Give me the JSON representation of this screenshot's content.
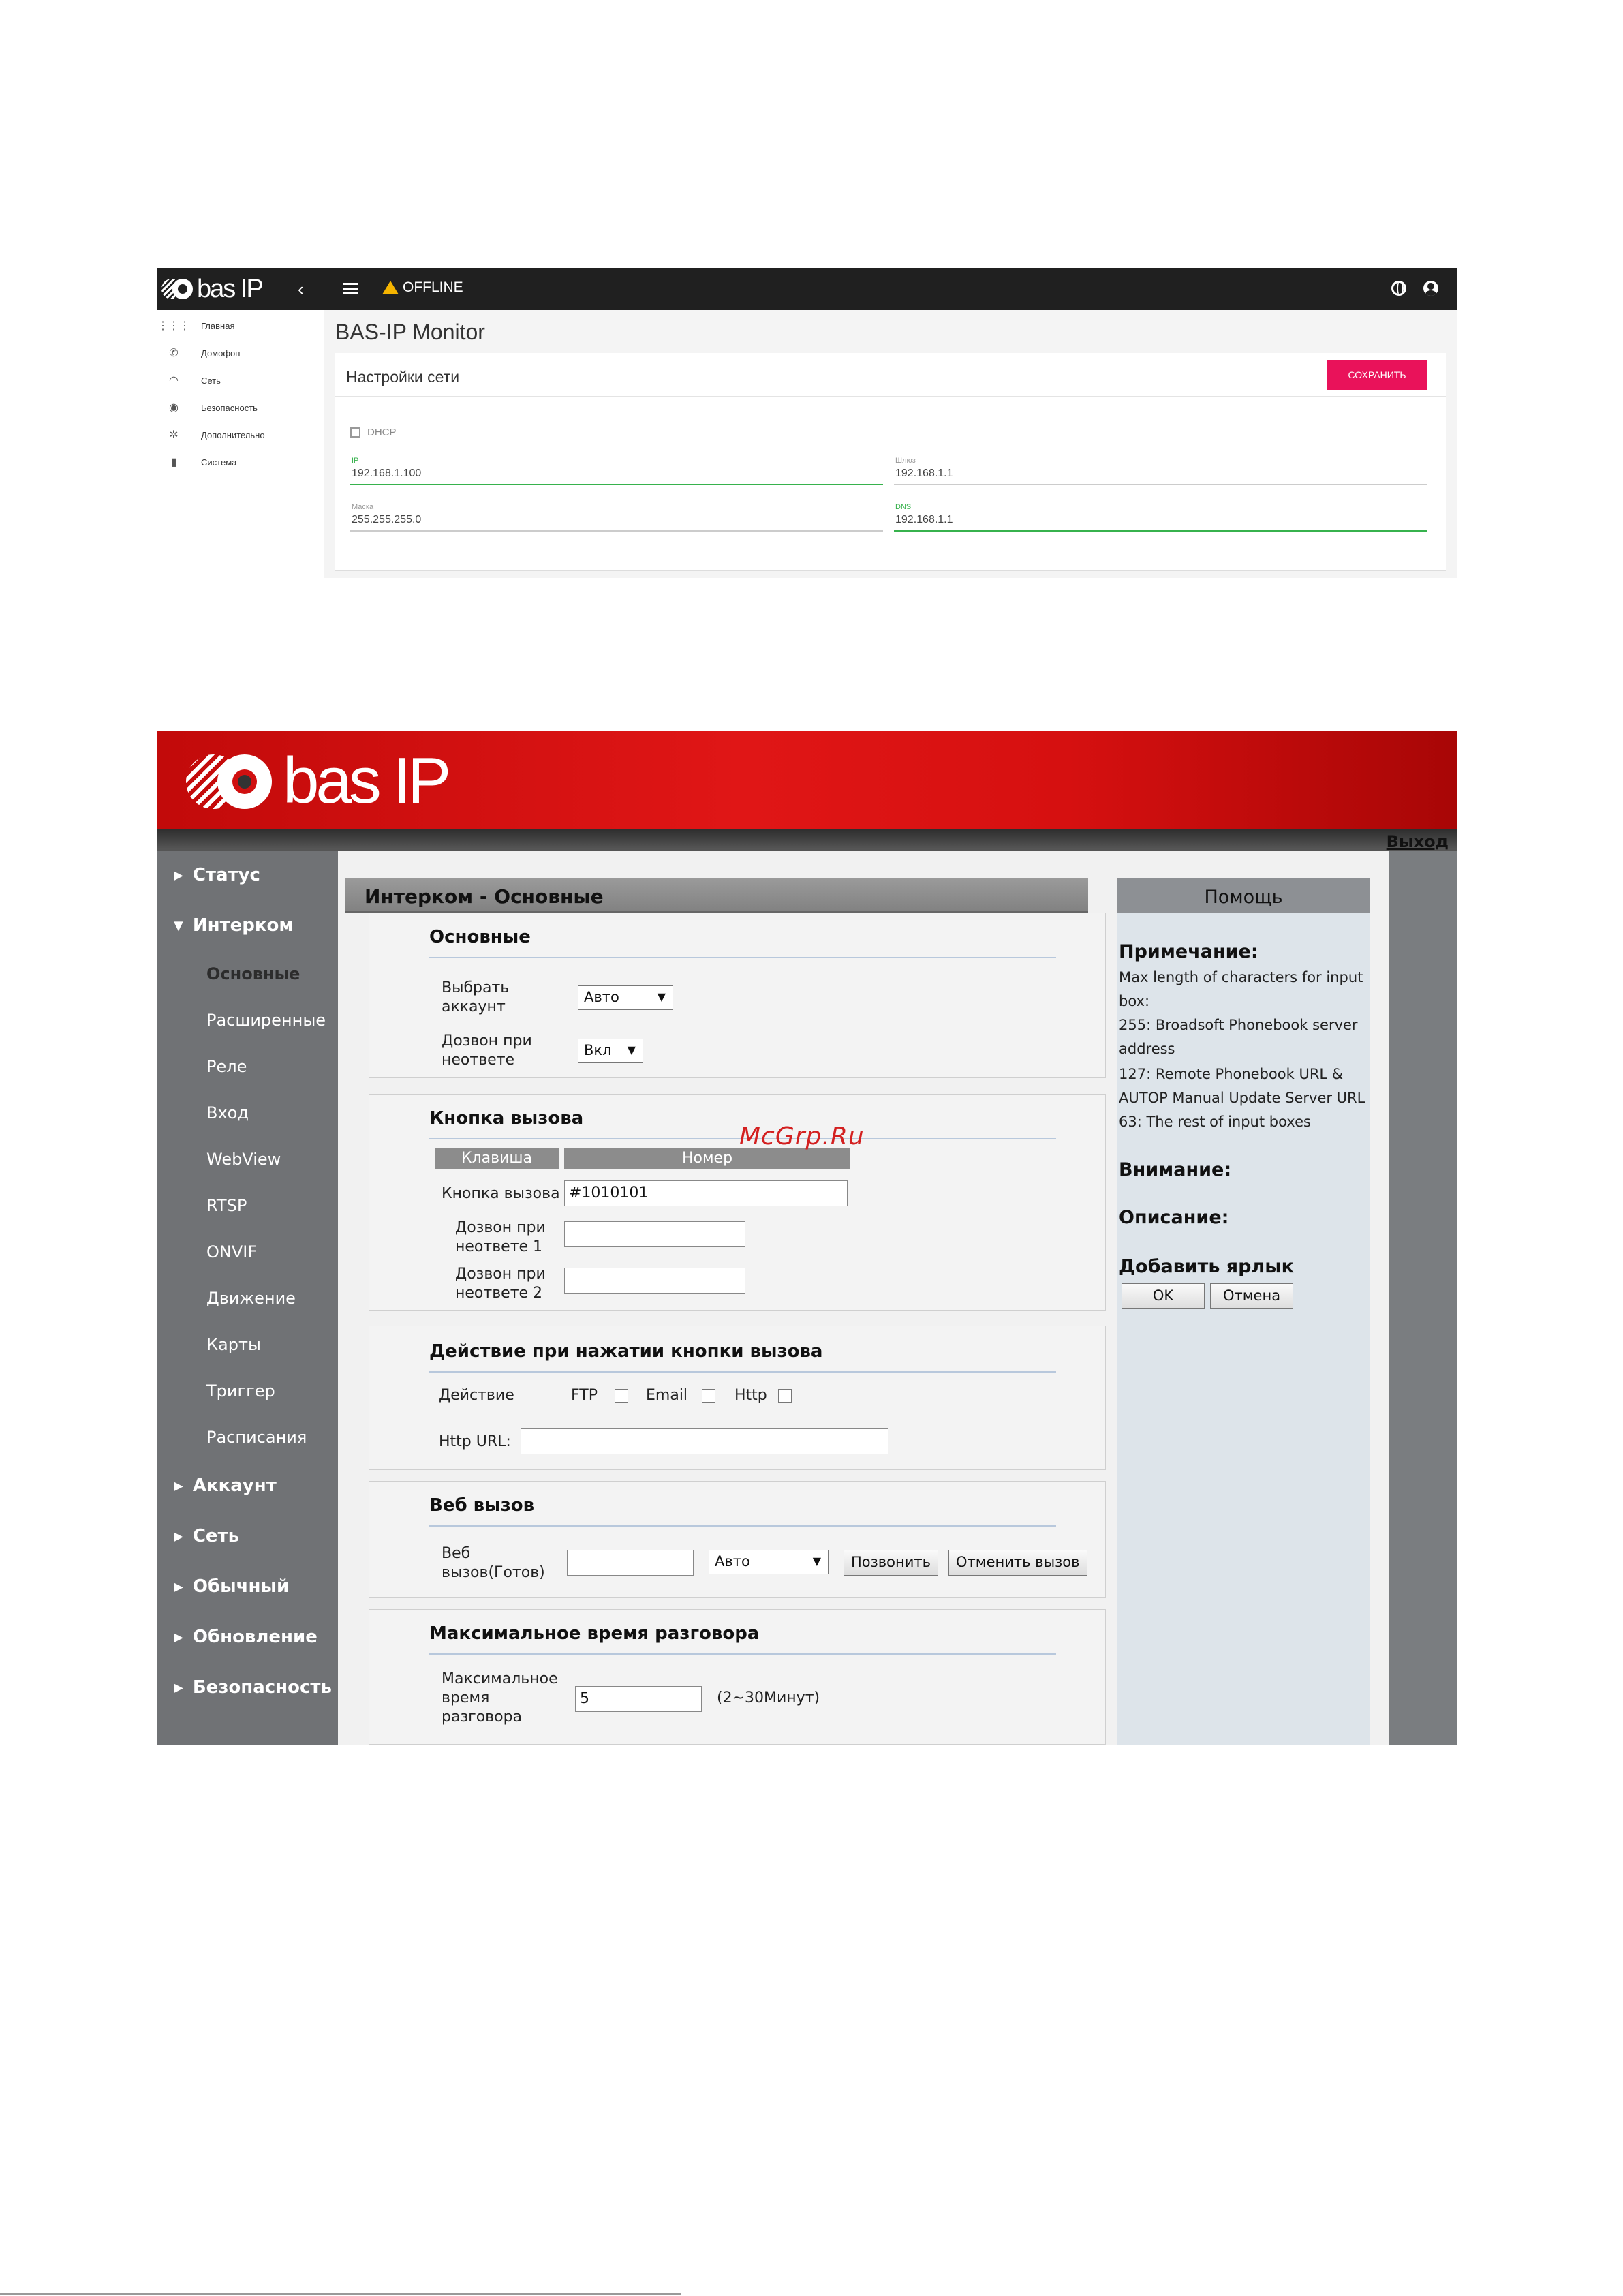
{
  "shot1": {
    "brand": "bas IP",
    "status": "OFFLINE",
    "app_title": "BAS-IP Monitor",
    "sidebar": [
      {
        "icon": "grid-icon",
        "label": "Главная"
      },
      {
        "icon": "phone-icon",
        "label": "Домофон"
      },
      {
        "icon": "wifi-icon",
        "label": "Сеть"
      },
      {
        "icon": "shield-icon",
        "label": "Безопасность"
      },
      {
        "icon": "gear-icon",
        "label": "Дополнительно"
      },
      {
        "icon": "system-icon",
        "label": "Система"
      }
    ],
    "card": {
      "title": "Настройки сети",
      "save_label": "СОХРАНИТЬ",
      "dhcp_label": "DHCP",
      "fields": {
        "ip": {
          "label": "IP",
          "value": "192.168.1.100"
        },
        "gateway": {
          "label": "Шлюз",
          "value": "192.168.1.1"
        },
        "mask": {
          "label": "Маска",
          "value": "255.255.255.0"
        },
        "dns": {
          "label": "DNS",
          "value": "192.168.1.1"
        }
      }
    },
    "colors": {
      "accent": "#e9125a",
      "active_field": "#37b24d",
      "topbar": "#202020"
    }
  },
  "shot2": {
    "brand": "bas IP",
    "logout": "Выход",
    "nav": {
      "status": "Статус",
      "intercom": "Интерком",
      "intercom_items": [
        "Основные",
        "Расширенные",
        "Реле",
        "Вход",
        "WebView",
        "RTSP",
        "ONVIF",
        "Движение",
        "Карты",
        "Триггер",
        "Расписания"
      ],
      "account": "Аккаунт",
      "network": "Сеть",
      "general": "Обычный",
      "update": "Обновление",
      "security": "Безопасность"
    },
    "page_title": "Интерком - Основные",
    "basic": {
      "title": "Основные",
      "account_label": "Выбрать аккаунт",
      "account_value": "Авто",
      "autoanswer_label": "Дозвон при неответе",
      "autoanswer_value": "Вкл"
    },
    "call_button": {
      "title": "Кнопка вызова",
      "col_key": "Клавиша",
      "col_number": "Номер",
      "row1_label": "Кнопка вызова",
      "row1_value": "#1010101",
      "row2_label": "Дозвон при неответе 1",
      "row2_value": "",
      "row3_label": "Дозвон при неответе 2",
      "row3_value": ""
    },
    "action": {
      "title": "Действие при нажатии кнопки вызова",
      "action_label": "Действие",
      "ftp": "FTP",
      "email": "Email",
      "http": "Http",
      "url_label": "Http URL:",
      "url_value": ""
    },
    "webcall": {
      "title": "Веб вызов",
      "label": "Веб вызов(Готов)",
      "value": "",
      "select_value": "Авто",
      "call_btn": "Позвонить",
      "cancel_btn": "Отменить вызов"
    },
    "maxtalk": {
      "title": "Максимальное время разговора",
      "label": "Максимальное время разговора",
      "value": "5",
      "hint": "(2~30Минут)"
    },
    "help": {
      "title": "Помощь",
      "note_title": "Примечание:",
      "note_lines": [
        "Max length of characters for input box:",
        "255: Broadsoft Phonebook server address",
        "127: Remote Phonebook URL & AUTOP Manual Update Server URL",
        "63: The rest of input boxes"
      ],
      "warning_title": "Внимание:",
      "description_title": "Описание:",
      "shortcut_title": "Добавить ярлык",
      "ok": "OK",
      "cancel": "Отмена"
    },
    "watermark": "McGrp.Ru",
    "colors": {
      "banner": "#d61010",
      "nav": "#707275",
      "help": "#dde4ea"
    }
  }
}
